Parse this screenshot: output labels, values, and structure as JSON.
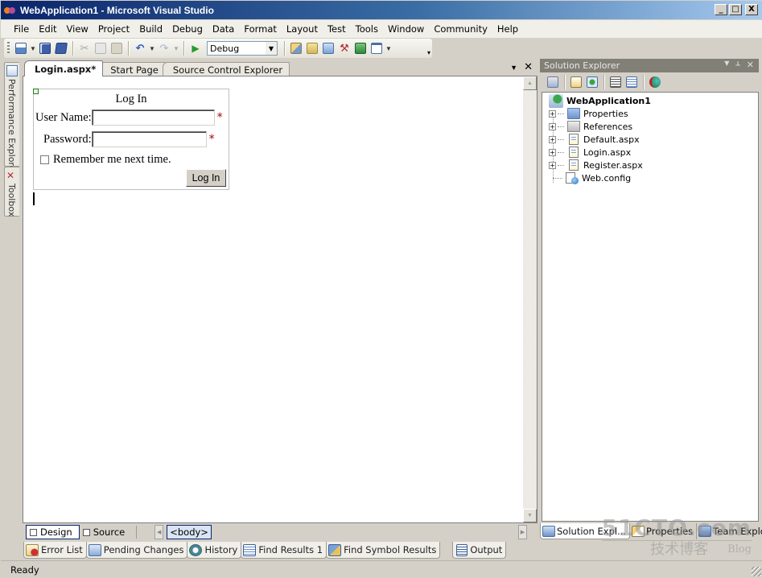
{
  "window": {
    "title": "WebApplication1 - Microsoft Visual Studio",
    "controls": {
      "minimize": "_",
      "maximize": "□",
      "close": "X"
    }
  },
  "menu": [
    "File",
    "Edit",
    "View",
    "Project",
    "Build",
    "Debug",
    "Data",
    "Format",
    "Layout",
    "Test",
    "Tools",
    "Window",
    "Community",
    "Help"
  ],
  "toolbar": {
    "buttons": [
      "add-new-item-icon",
      "save-icon",
      "save-all-icon",
      "cut-icon",
      "copy-icon",
      "paste-icon",
      "undo-icon",
      "redo-icon",
      "start-debugging-icon",
      "find-in-files-icon",
      "solution-explorer-icon",
      "properties-icon",
      "toolbox-icon",
      "object-browser-icon",
      "command-window-icon"
    ],
    "configuration": "Debug"
  },
  "left_strip": {
    "tabs": [
      {
        "label": "Performance Explorer",
        "icon": "performance-explorer-icon"
      },
      {
        "label": "Toolbox",
        "icon": "toolbox-icon"
      }
    ]
  },
  "document": {
    "tabs": [
      {
        "label": "Login.aspx*",
        "active": true
      },
      {
        "label": "Start Page",
        "active": false
      },
      {
        "label": "Source Control Explorer",
        "active": false
      }
    ],
    "login_control": {
      "title": "Log In",
      "username_label": "User Name:",
      "username_value": "",
      "password_label": "Password:",
      "password_value": "",
      "required_marker": "*",
      "remember_label": "Remember me next time.",
      "remember_checked": false,
      "button_label": "Log In"
    },
    "view_tabs": [
      {
        "label": "Design",
        "active": true
      },
      {
        "label": "Source",
        "active": false
      }
    ],
    "tag_navigator": "<body>"
  },
  "solution_explorer": {
    "title": "Solution Explorer",
    "project": "WebApplication1",
    "items": [
      {
        "label": "Properties",
        "type": "folder",
        "expandable": true
      },
      {
        "label": "References",
        "type": "references",
        "expandable": true
      },
      {
        "label": "Default.aspx",
        "type": "page",
        "expandable": true
      },
      {
        "label": "Login.aspx",
        "type": "page",
        "expandable": true
      },
      {
        "label": "Register.aspx",
        "type": "page",
        "expandable": true
      },
      {
        "label": "Web.config",
        "type": "config",
        "expandable": false
      }
    ],
    "bottom_tabs": [
      {
        "label": "Solution Expl...",
        "active": true
      },
      {
        "label": "Properties",
        "active": false
      },
      {
        "label": "Team Explorer",
        "active": false
      }
    ]
  },
  "tool_tabs": [
    "Error List",
    "Pending Changes",
    "History",
    "Find Results 1",
    "Find Symbol Results",
    "Output"
  ],
  "status": "Ready",
  "watermark": {
    "line1": "51CTO.com",
    "line2": "技术博客",
    "line3": "Blog"
  }
}
